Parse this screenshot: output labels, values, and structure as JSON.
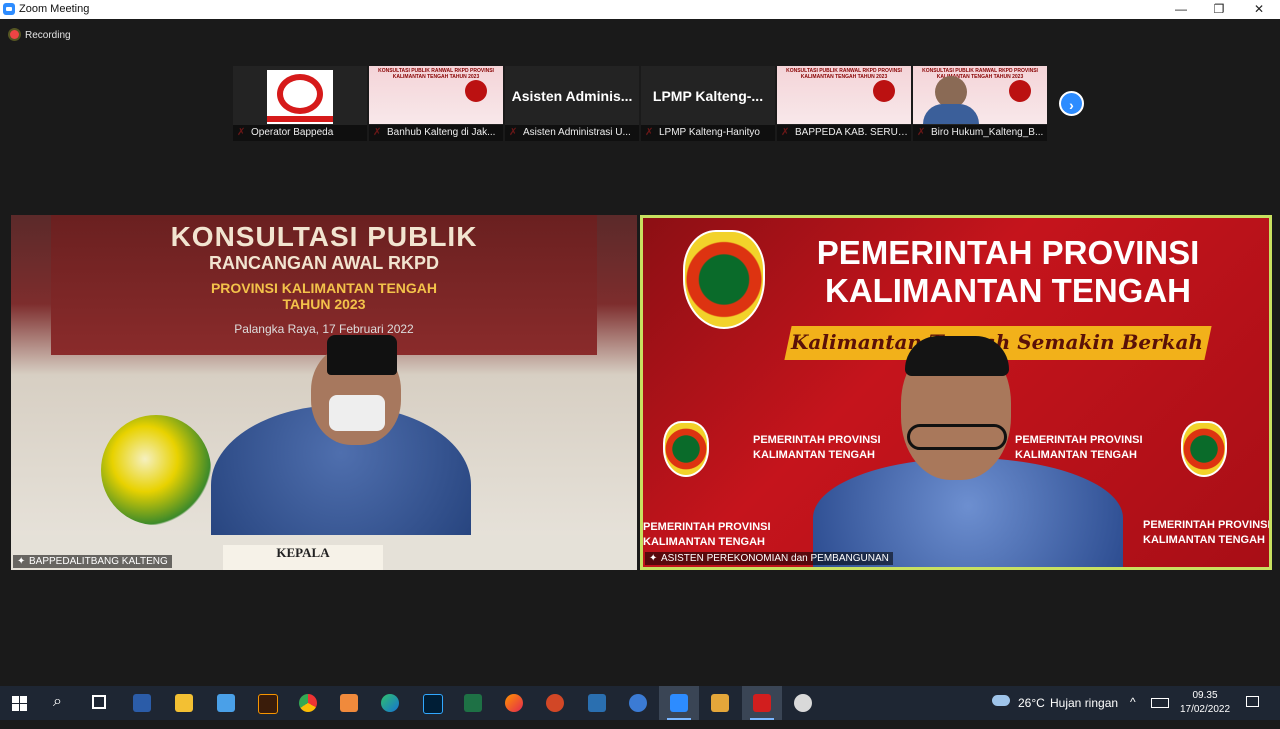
{
  "window": {
    "title": "Zoom Meeting",
    "min": "—",
    "max": "❐",
    "close": "✕"
  },
  "recording": {
    "label": "Recording"
  },
  "thumbnails": [
    {
      "name": "Operator Bappeda",
      "kind": "logo",
      "big": ""
    },
    {
      "name": "Banhub Kalteng di Jak...",
      "kind": "slide",
      "big": ""
    },
    {
      "name": "Asisten Administrasi U...",
      "kind": "text",
      "big": "Asisten Adminis..."
    },
    {
      "name": "LPMP Kalteng-Hanityo",
      "kind": "text",
      "big": "LPMP Kalteng-..."
    },
    {
      "name": "BAPPEDA KAB. SERUY...",
      "kind": "slide",
      "big": ""
    },
    {
      "name": "Biro Hukum_Kalteng_B...",
      "kind": "slide",
      "big": ""
    }
  ],
  "slide_title": "KONSULTASI PUBLIK RANWAL RKPD PROVINSI KALIMANTAN TENGAH TAHUN 2023",
  "next_icon": "chevron-right-icon",
  "left_tile": {
    "banner_line1": "KONSULTASI PUBLIK",
    "banner_line2": "RANCANGAN AWAL RKPD",
    "banner_line3": "PROVINSI KALIMANTAN TENGAH",
    "banner_line4": "TAHUN 2023",
    "banner_line5": "Palangka Raya, 17 Februari 2022",
    "plate": "KEPALA",
    "name": "BAPPEDALITBANG KALTENG"
  },
  "right_tile": {
    "title_line1": "PEMERINTAH PROVINSI",
    "title_line2": "KALIMANTAN TENGAH",
    "tagline": "Kalimantan Tengah Semakin Berkah",
    "small_line1": "PEMERINTAH PROVINSI",
    "small_line2": "KALIMANTAN TENGAH",
    "name": "ASISTEN PEREKONOMIAN dan PEMBANGUNAN",
    "active_speaker_color": "#c8e060"
  },
  "taskbar": {
    "icons": [
      "windows-icon",
      "search-icon",
      "task-view-icon",
      "word-icon",
      "file-explorer-icon",
      "remote-icon",
      "illustrator-icon",
      "chrome-icon",
      "app-icon",
      "edge-icon",
      "photoshop-icon",
      "excel-icon",
      "firefox-icon",
      "powerpoint-icon",
      "app2-icon",
      "app3-icon",
      "zoom-icon",
      "media-icon",
      "acrobat-icon",
      "app4-icon"
    ],
    "weather_temp": "26°C",
    "weather_text": "Hujan ringan",
    "time": "09.35",
    "date": "17/02/2022"
  }
}
